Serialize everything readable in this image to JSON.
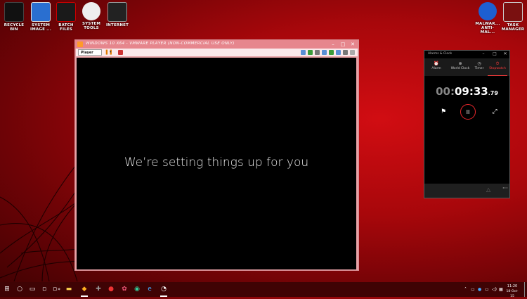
{
  "desktop": {
    "icons_left": [
      {
        "label": "RECYCLE BIN",
        "icon": "recycle-bin-icon"
      },
      {
        "label": "SYSTEM IMAGE ...",
        "icon": "system-image-icon"
      },
      {
        "label": "BATCH FILES",
        "icon": "batch-files-icon"
      },
      {
        "label": "SYSTEM TOOLS",
        "icon": "system-tools-icon"
      },
      {
        "label": "INTERNET",
        "icon": "internet-icon"
      }
    ],
    "icons_right": [
      {
        "label": "MALWAR... ANTI-MAL...",
        "icon": "malwarebytes-icon"
      },
      {
        "label": "TASK MANAGER",
        "icon": "task-manager-icon"
      }
    ]
  },
  "vmware": {
    "title": "WINDOWS 10 X64 - VMWARE PLAYER (NON-COMMERCIAL USE ONLY)",
    "player_menu": "Player",
    "guest_message": "We’re setting things up for you",
    "controls": {
      "minimize": "–",
      "maximize": "□",
      "close": "✕"
    }
  },
  "alarms_clock": {
    "title": "Alarms & Clock",
    "tabs": [
      {
        "label": "Alarm",
        "icon": "⏰"
      },
      {
        "label": "World Clock",
        "icon": "⊕"
      },
      {
        "label": "Timer",
        "icon": "◷"
      },
      {
        "label": "Stopwatch",
        "icon": "⏱"
      }
    ],
    "active_tab": "Stopwatch",
    "stopwatch": {
      "hours": "00:",
      "time": "09:33",
      "centis": ".79"
    },
    "buttons": {
      "lap": "⚑",
      "pause": "II",
      "expand": "⤢",
      "more": "···"
    },
    "accent": "#e8262b"
  },
  "taskbar": {
    "start": "⊞",
    "search": "○",
    "task_view": "▭",
    "tray_chevron": "˄",
    "time": "11:20",
    "date": "18-Oct-15"
  }
}
